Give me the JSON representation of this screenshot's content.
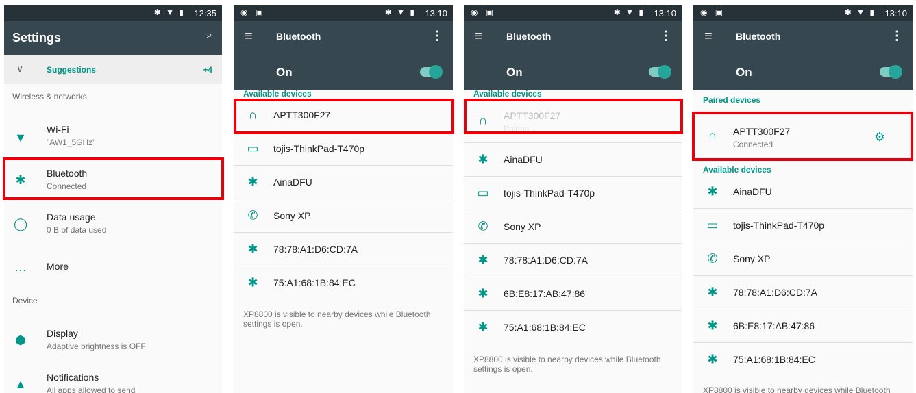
{
  "accent": "#009688",
  "highlight": "#e8000b",
  "panel1": {
    "time": "12:35",
    "title": "Settings",
    "suggestions": "Suggestions",
    "suggestions_count": "+4",
    "cat_wireless": "Wireless & networks",
    "items": [
      {
        "title": "Wi-Fi",
        "sub": "\"AW1_5GHz\"",
        "icon": "wifi-icon"
      },
      {
        "title": "Bluetooth",
        "sub": "Connected",
        "icon": "bluetooth-icon"
      },
      {
        "title": "Data usage",
        "sub": "0 B of data used",
        "icon": "data-usage-icon"
      },
      {
        "title": "More",
        "sub": "",
        "icon": "more-icon"
      }
    ],
    "cat_device": "Device",
    "device_items": [
      {
        "title": "Display",
        "sub": "Adaptive brightness is OFF",
        "icon": "display-icon"
      },
      {
        "title": "Notifications",
        "sub": "All apps allowed to send",
        "icon": "bell-icon"
      }
    ]
  },
  "panel2": {
    "time": "13:10",
    "title": "Bluetooth",
    "on": "On",
    "available": "Available devices",
    "devices": [
      "APTT300F27",
      "tojis-ThinkPad-T470p",
      "AinaDFU",
      "Sony XP",
      "78:78:A1:D6:CD:7A",
      "75:A1:68:1B:84:EC"
    ],
    "note": "XP8800 is visible to nearby devices while Bluetooth settings is open."
  },
  "panel3": {
    "time": "13:10",
    "title": "Bluetooth",
    "on": "On",
    "available": "Available devices",
    "pairing_device": "APTT300F27",
    "pairing_status": "Pairing...",
    "devices": [
      "AinaDFU",
      "tojis-ThinkPad-T470p",
      "Sony XP",
      "78:78:A1:D6:CD:7A",
      "6B:E8:17:AB:47:86",
      "75:A1:68:1B:84:EC"
    ],
    "note": "XP8800 is visible to nearby devices while Bluetooth settings is open."
  },
  "panel4": {
    "time": "13:10",
    "title": "Bluetooth",
    "on": "On",
    "paired": "Paired devices",
    "paired_device": "APTT300F27",
    "paired_status": "Connected",
    "available": "Available devices",
    "devices": [
      "AinaDFU",
      "tojis-ThinkPad-T470p",
      "Sony XP",
      "78:78:A1:D6:CD:7A",
      "6B:E8:17:AB:47:86",
      "75:A1:68:1B:84:EC"
    ],
    "note": "XP8800 is visible to nearby devices while Bluetooth"
  }
}
